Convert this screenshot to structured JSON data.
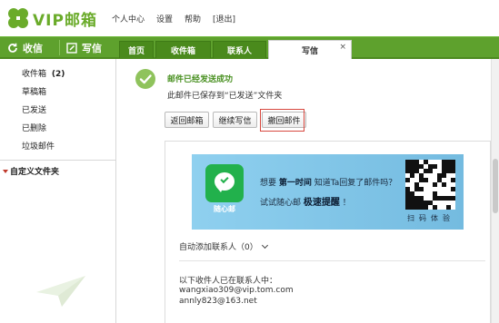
{
  "header": {
    "logo_text": "VIP邮箱",
    "nav": [
      "个人中心",
      "设置",
      "帮助",
      "[退出]"
    ]
  },
  "toolbar": {
    "receive_label": "收信",
    "compose_label": "写信",
    "tabs": [
      {
        "label": "首页"
      },
      {
        "label": "收件箱"
      },
      {
        "label": "联系人"
      },
      {
        "label": "写信",
        "close": "×"
      }
    ]
  },
  "sidebar": {
    "folders": [
      {
        "label": "收件箱",
        "count": "(2)"
      },
      {
        "label": "草稿箱"
      },
      {
        "label": "已发送"
      },
      {
        "label": "已删除"
      },
      {
        "label": "垃圾邮件"
      }
    ],
    "custom_folder_label": "自定义文件夹"
  },
  "main": {
    "success_title": "邮件已经发送成功",
    "saved_note": "此邮件已保存到“已发送”文件夹",
    "buttons": {
      "back": "返回邮箱",
      "continue": "继续写信",
      "recall": "撤回邮件"
    },
    "banner": {
      "app_name": "随心邮",
      "line1_prefix": "想要",
      "line1_bold": "第一时间",
      "line1_suffix": "知道Ta回复了邮件吗？",
      "line2_prefix": "试试随心邮",
      "line2_bold": "极速提醒",
      "line2_suffix": "！",
      "qr_label": "扫码体验"
    },
    "auto_add": "自动添加联系人（0）",
    "contacts_label": "以下收件人已在联系人中：",
    "contacts": [
      "wangxiao309@vip.tom.com",
      "annly823@163.net"
    ]
  },
  "colors": {
    "brand_green": "#5ea12d",
    "success_green": "#4a9122",
    "highlight_red": "#d7483f",
    "banner_blue": "#7ec1e5"
  }
}
